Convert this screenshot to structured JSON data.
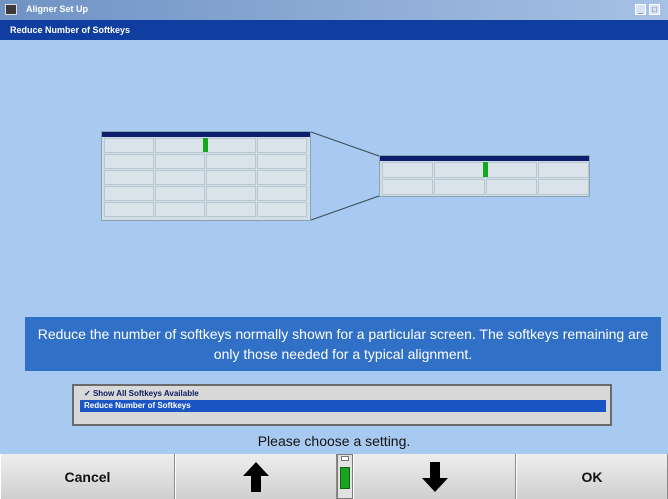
{
  "window": {
    "title": "Aligner Set Up",
    "subtitle": "Reduce Number of Softkeys"
  },
  "info": {
    "text": "Reduce the number of softkeys normally shown for a particular screen.  The softkeys remaining are only those needed for a typical alignment."
  },
  "options": {
    "items": [
      {
        "check": "✓",
        "label": "Show All Softkeys Available"
      },
      {
        "check": "",
        "label": "Reduce Number of Softkeys"
      }
    ],
    "selected": "Reduce Number of Softkeys"
  },
  "prompt": "Please choose a setting.",
  "softkeys": {
    "cancel": "Cancel",
    "up_icon": "arrow-up-icon",
    "down_icon": "arrow-down-icon",
    "ok": "OK"
  },
  "colors": {
    "background": "#a9caf0",
    "title_bar": "#0f3da0",
    "info_box": "#3070c6",
    "selection": "#1a55c3",
    "indicator_green": "#14a81e"
  }
}
